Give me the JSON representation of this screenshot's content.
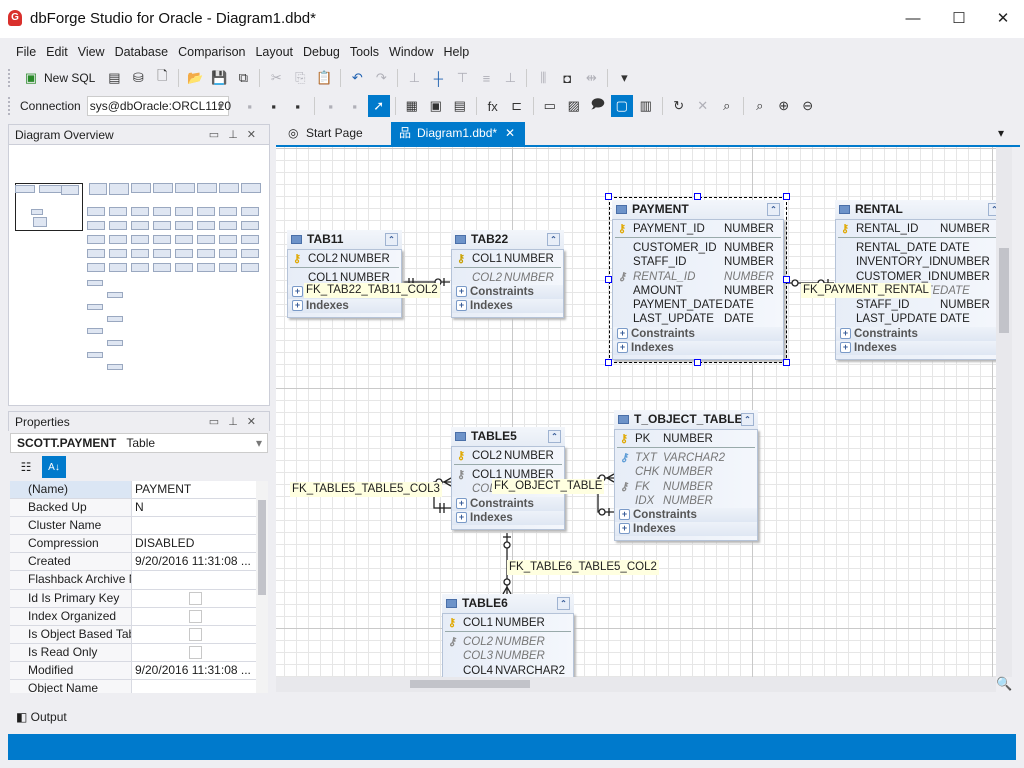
{
  "window": {
    "title": "dbForge Studio for Oracle - Diagram1.dbd*",
    "app_icon": "G"
  },
  "menu": [
    "File",
    "Edit",
    "View",
    "Database",
    "Comparison",
    "Layout",
    "Debug",
    "Tools",
    "Window",
    "Help"
  ],
  "toolbar1": {
    "new_sql_label": "New SQL",
    "icons": [
      "new-document-icon",
      "new-database-object-icon",
      "new-file-icon",
      "open-icon",
      "save-icon",
      "save-all-icon",
      "cut-icon",
      "copy-icon",
      "paste-icon",
      "undo-icon",
      "redo-icon",
      "align-left-icon",
      "align-center-icon",
      "align-top-icon",
      "align-middle-icon",
      "align-bottom-icon",
      "distribute-icon",
      "bring-to-front-icon",
      "spacing-icon",
      "overflow-icon"
    ]
  },
  "toolbar2": {
    "connection_label": "Connection",
    "connection_value": "sys@dbOracle:ORCL1120",
    "icons": [
      "database-disconnect-icon",
      "database-connect-icon",
      "database-edit-icon",
      "database-refresh-icon",
      "database-sync-icon",
      "pointer-icon",
      "table-icon",
      "view-icon",
      "procedure-icon",
      "function-icon",
      "relation-icon",
      "container-icon",
      "image-icon",
      "note-icon",
      "comment-icon",
      "stamp-icon",
      "refresh-icon",
      "delete-icon",
      "zoom-fit-icon",
      "zoom-reset-icon",
      "zoom-in-icon",
      "zoom-out-icon"
    ]
  },
  "overview": {
    "title": "Diagram Overview"
  },
  "properties": {
    "title": "Properties",
    "object": "SCOTT.PAYMENT",
    "object_type": "Table",
    "rows": [
      {
        "name": "(Name)",
        "value": "PAYMENT"
      },
      {
        "name": "Backed Up",
        "value": "N"
      },
      {
        "name": "Cluster Name",
        "value": ""
      },
      {
        "name": "Compression",
        "value": "DISABLED"
      },
      {
        "name": "Created",
        "value": "9/20/2016 11:31:08 ..."
      },
      {
        "name": "Flashback Archive Na",
        "value": ""
      },
      {
        "name": "Id Is Primary Key",
        "checkbox": false
      },
      {
        "name": "Index Organized",
        "checkbox": false
      },
      {
        "name": "Is Object Based Table",
        "checkbox": false
      },
      {
        "name": "Is Read Only",
        "checkbox": false
      },
      {
        "name": "Modified",
        "value": "9/20/2016 11:31:08 ..."
      },
      {
        "name": "Object Name",
        "value": ""
      }
    ]
  },
  "tabs": [
    {
      "label": "Start Page",
      "active": false
    },
    {
      "label": "Diagram1.dbd*",
      "active": true
    }
  ],
  "diagram": {
    "sections": [
      "Constraints",
      "Indexes"
    ],
    "tables": [
      {
        "name": "TAB11",
        "columns": [
          {
            "n": "COL2",
            "t": "NUMBER",
            "key": "pk",
            "sep": true
          },
          {
            "n": "COL1",
            "t": "NUMBER"
          }
        ]
      },
      {
        "name": "TAB22",
        "columns": [
          {
            "n": "COL1",
            "t": "NUMBER",
            "key": "pkfk",
            "sep": true
          },
          {
            "n": "COL2",
            "t": "NUMBER",
            "italic": true
          }
        ]
      },
      {
        "name": "PAYMENT",
        "selected": true,
        "columns": [
          {
            "n": "PAYMENT_ID",
            "t": "NUMBER",
            "key": "pk",
            "sep": true
          },
          {
            "n": "CUSTOMER_ID",
            "t": "NUMBER"
          },
          {
            "n": "STAFF_ID",
            "t": "NUMBER"
          },
          {
            "n": "RENTAL_ID",
            "t": "NUMBER",
            "key": "fk",
            "italic": true
          },
          {
            "n": "AMOUNT",
            "t": "NUMBER"
          },
          {
            "n": "PAYMENT_DATE",
            "t": "DATE"
          },
          {
            "n": "LAST_UPDATE",
            "t": "DATE"
          }
        ]
      },
      {
        "name": "RENTAL",
        "columns": [
          {
            "n": "RENTAL_ID",
            "t": "NUMBER",
            "key": "pk",
            "sep": true
          },
          {
            "n": "RENTAL_DATE",
            "t": "DATE"
          },
          {
            "n": "INVENTORY_ID",
            "t": "NUMBER"
          },
          {
            "n": "CUSTOMER_ID",
            "t": "NUMBER"
          },
          {
            "n": "RETURN_DATE",
            "t": "DATE",
            "italic": true
          },
          {
            "n": "STAFF_ID",
            "t": "NUMBER"
          },
          {
            "n": "LAST_UPDATE",
            "t": "DATE"
          }
        ]
      },
      {
        "name": "TABLE5",
        "columns": [
          {
            "n": "COL2",
            "t": "NUMBER",
            "key": "pk",
            "sep": true
          },
          {
            "n": "COL1",
            "t": "NUMBER",
            "key": "fk"
          },
          {
            "n": "COL3",
            "t": "NUMBER",
            "italic": true
          }
        ]
      },
      {
        "name": "T_OBJECT_TABLE",
        "columns": [
          {
            "n": "PK",
            "t": "NUMBER",
            "key": "pk",
            "sep": true
          },
          {
            "n": "TXT",
            "t": "VARCHAR2",
            "key": "uk",
            "italic": true
          },
          {
            "n": "CHK",
            "t": "NUMBER",
            "italic": true
          },
          {
            "n": "FK",
            "t": "NUMBER",
            "key": "fk",
            "italic": true
          },
          {
            "n": "IDX",
            "t": "NUMBER",
            "italic": true
          }
        ]
      },
      {
        "name": "TABLE6",
        "columns": [
          {
            "n": "COL1",
            "t": "NUMBER",
            "key": "pk",
            "sep": true
          },
          {
            "n": "COL2",
            "t": "NUMBER",
            "key": "fk",
            "italic": true
          },
          {
            "n": "COL3",
            "t": "NUMBER",
            "italic": true
          },
          {
            "n": "COL4",
            "t": "NVARCHAR2"
          }
        ]
      }
    ],
    "relations": [
      "FK_TAB22_TAB11_COL2",
      "FK_PAYMENT_RENTAL",
      "FK_TABLE5_TABLE5_COL3",
      "FK_OBJECT_TABLE",
      "FK_TABLE6_TABLE5_COL2"
    ]
  },
  "output": {
    "label": "Output"
  },
  "colors": {
    "accent": "#007acc",
    "key_pk": "#e0a800",
    "key_fk": "#888888",
    "key_uk": "#5b9bd5",
    "relation_label_bg": "#ffffe0"
  }
}
